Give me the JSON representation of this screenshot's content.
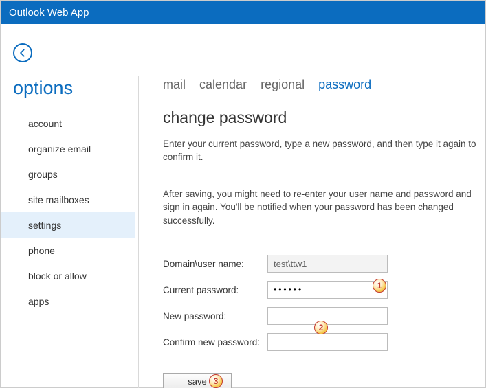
{
  "titlebar": {
    "appName": "Outlook Web App"
  },
  "options": {
    "title": "options",
    "items": [
      {
        "label": "account"
      },
      {
        "label": "organize email"
      },
      {
        "label": "groups"
      },
      {
        "label": "site mailboxes"
      },
      {
        "label": "settings"
      },
      {
        "label": "phone"
      },
      {
        "label": "block or allow"
      },
      {
        "label": "apps"
      }
    ],
    "selectedIndex": 4
  },
  "main": {
    "tabs": [
      {
        "label": "mail"
      },
      {
        "label": "calendar"
      },
      {
        "label": "regional"
      },
      {
        "label": "password"
      }
    ],
    "activeTabIndex": 3,
    "heading": "change password",
    "description1": "Enter your current password, type a new password, and then type it again to confirm it.",
    "description2": "After saving, you might need to re-enter your user name and password and sign in again. You'll be notified when your password has been changed successfully.",
    "form": {
      "domainLabel": "Domain\\user name:",
      "domainValue": "test\\ttw1",
      "currentLabel": "Current password:",
      "currentValue": "••••••",
      "newLabel": "New password:",
      "newValue": "",
      "confirmLabel": "Confirm new password:",
      "confirmValue": ""
    },
    "saveLabel": "save"
  },
  "annotations": {
    "badge1": "1",
    "badge2": "2",
    "badge3": "3"
  }
}
